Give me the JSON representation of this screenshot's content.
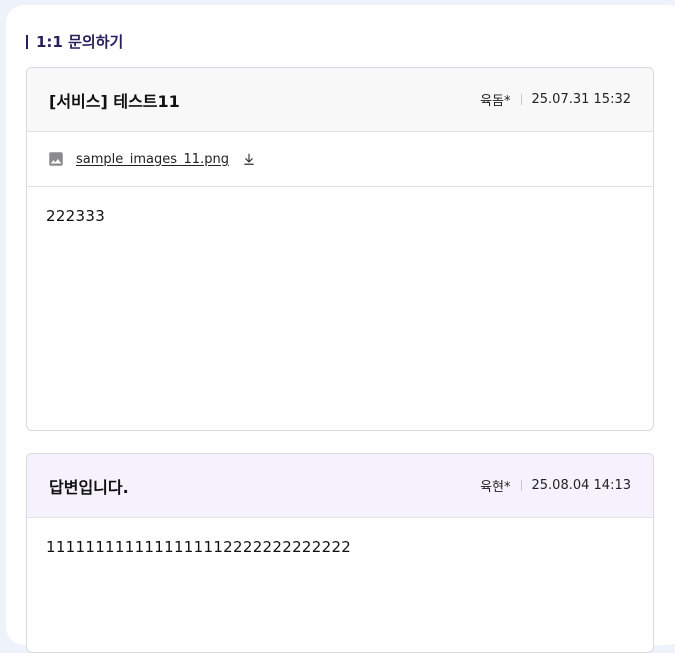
{
  "section": {
    "title": "1:1 문의하기"
  },
  "question": {
    "title": "[서비스] 테스트11",
    "author": "육돔*",
    "date": "25.07.31 15:32",
    "attachment": {
      "file_name": "sample_images_11.png",
      "icon": "image-icon",
      "download_icon": "download-icon"
    },
    "body": "222333"
  },
  "answer": {
    "title": "답변입니다.",
    "author": "육현*",
    "date": "25.08.04 14:13",
    "body": "1111111111111111112222222222222"
  }
}
